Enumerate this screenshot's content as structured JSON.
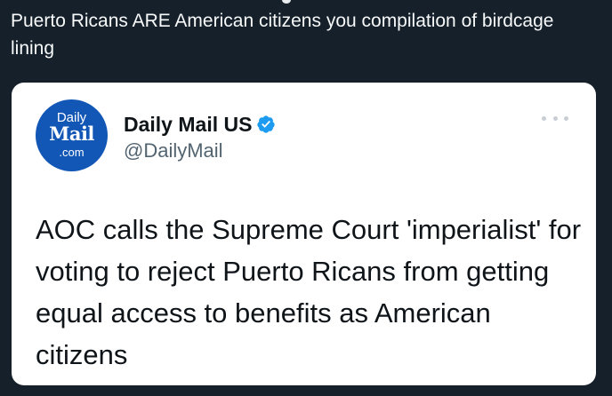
{
  "post": {
    "caption": "Puerto Ricans ARE American citizens you compilation of birdcage lining"
  },
  "quoted_tweet": {
    "avatar": {
      "line1": "Daily",
      "line2": "Mail",
      "line3": ".com",
      "color": "#1257b5"
    },
    "display_name": "Daily Mail US",
    "handle": "@DailyMail",
    "verified_icon": "verified-badge-icon",
    "verified_color": "#1d9bf0",
    "more_icon": "more-options-icon",
    "text": "AOC calls the Supreme Court 'imperialist' for voting to reject Puerto Ricans from getting equal access to benefits as American citizens"
  }
}
